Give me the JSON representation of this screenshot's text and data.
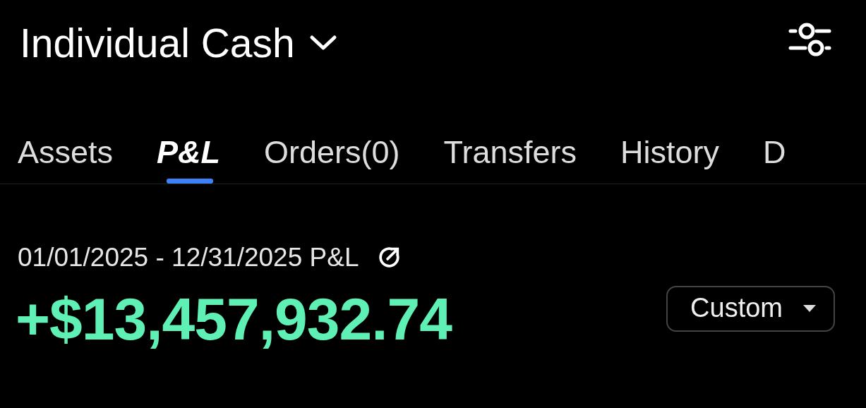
{
  "header": {
    "title": "Individual Cash"
  },
  "tabs": [
    {
      "label": "Assets",
      "selected": false
    },
    {
      "label": "P&L",
      "selected": true
    },
    {
      "label": "Orders(0)",
      "selected": false
    },
    {
      "label": "Transfers",
      "selected": false
    },
    {
      "label": "History",
      "selected": false
    },
    {
      "label": "D",
      "selected": false
    }
  ],
  "pnl": {
    "period": "01/01/2025 - 12/31/2025 P&L",
    "amount": "+$13,457,932.74",
    "range": "Custom"
  }
}
